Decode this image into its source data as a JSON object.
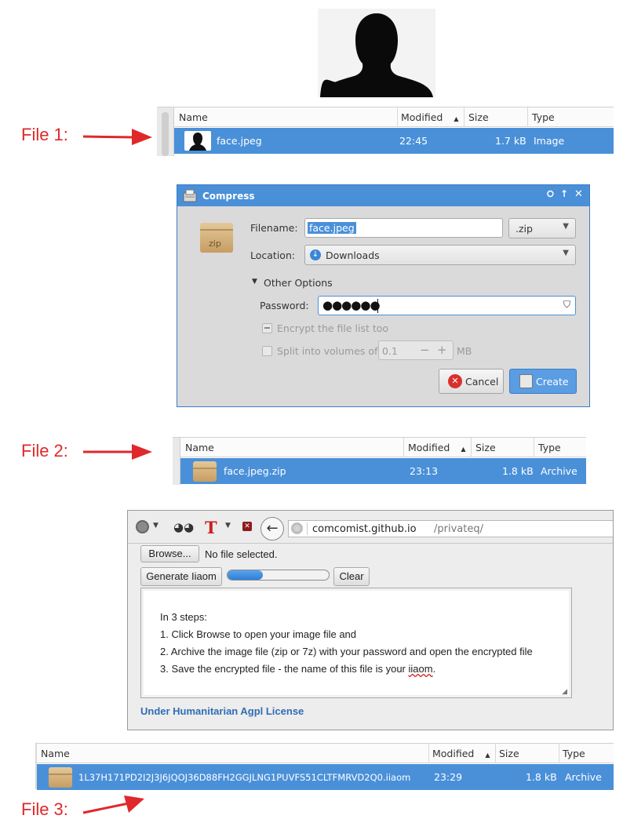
{
  "callouts": {
    "file1": "File 1:",
    "file2": "File 2:",
    "file3": "File 3:"
  },
  "colors": {
    "selection": "#4a90d9",
    "callout": "#e0282b",
    "license": "#2f6db5",
    "progress": "#3b8de0"
  },
  "list1": {
    "columns": {
      "name": "Name",
      "modified": "Modified",
      "size": "Size",
      "type": "Type"
    },
    "row": {
      "icon": "face-thumbnail-icon",
      "name": "face.jpeg",
      "modified": "22:45",
      "size": "1.7 kB",
      "type": "Image"
    }
  },
  "dialog": {
    "title": "Compress",
    "filename_label": "Filename:",
    "filename_value": "face.jpeg",
    "extension": ".zip",
    "location_label": "Location:",
    "location_value": "Downloads",
    "package_label": "zip",
    "other_options": "Other Options",
    "password_label": "Password:",
    "password_value": "●●●●●●",
    "encrypt_label": "Encrypt the file list too",
    "split_label": "Split into volumes of",
    "split_value": "0.1",
    "split_unit": "MB",
    "cancel": "Cancel",
    "create": "Create"
  },
  "list2": {
    "columns": {
      "name": "Name",
      "modified": "Modified",
      "size": "Size",
      "type": "Type"
    },
    "row": {
      "icon": "archive-icon",
      "name": "face.jpeg.zip",
      "modified": "23:13",
      "size": "1.8 kB",
      "type": "Archive"
    }
  },
  "browser": {
    "url_host": "comcomist.github.io",
    "url_path": "/privateq/",
    "browse": "Browse...",
    "no_file": "No file selected.",
    "generate": "Generate Iiaom",
    "progress": 0.35,
    "clear": "Clear",
    "steps_title": "In 3 steps:",
    "steps": [
      "1. Click Browse to open your image file and",
      "2. Archive the image file (zip or 7z) with your password and open the encrypted file",
      "3. Save the encrypted file - the name of this file is your "
    ],
    "steps_last_word": "iiaom",
    "steps_last_tail": ".",
    "license": "Under Humanitarian Agpl License"
  },
  "list3": {
    "columns": {
      "name": "Name",
      "modified": "Modified",
      "size": "Size",
      "type": "Type"
    },
    "row": {
      "icon": "archive-icon",
      "name": "1L37H171PD2I2J3J6JQOJ36D88FH2GGJLNG1PUVFS51CLTFMRVD2Q0.iiaom",
      "modified": "23:29",
      "size": "1.8 kB",
      "type": "Archive"
    }
  }
}
